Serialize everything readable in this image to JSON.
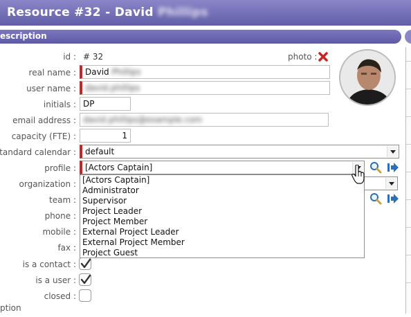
{
  "window": {
    "title": "Resource  #32 - David",
    "title_surname": "Phillips"
  },
  "section": {
    "title": "escription"
  },
  "fields": {
    "id_label": "id :",
    "id_value": "#  32",
    "photo_label": "photo :",
    "real_name_label": "real name :",
    "real_name_value": "David",
    "real_name_hidden": "Phillips",
    "user_name_label": "user name :",
    "user_name_hidden": "david.phillips",
    "initials_label": "initials :",
    "initials_value": "DP",
    "email_label": "email address :",
    "email_hidden": "david.phillips@example.com",
    "capacity_label": "capacity (FTE) :",
    "capacity_value": "1",
    "calendar_label": "standard calendar :",
    "calendar_value": "default",
    "profile_label": "profile :",
    "profile_value": "[Actors Captain]",
    "organization_label": "organization :",
    "team_label": "team :",
    "phone_label": "phone :",
    "mobile_label": "mobile :",
    "fax_label": "fax :",
    "is_contact_label": "is a contact :",
    "is_user_label": "is a user :",
    "closed_label": "closed :",
    "is_contact_checked": true,
    "is_user_checked": true,
    "closed_checked": false
  },
  "profile_options": [
    "[Actors Captain]",
    "Administrator",
    "Supervisor",
    "Project Leader",
    "Project Member",
    "External Project Leader",
    "External Project Member",
    "Project Guest"
  ],
  "footer": {
    "label": "ption"
  },
  "colors": {
    "header": "#625ea8",
    "required": "#cc2222",
    "delete": "#cc2222",
    "goto": "#2a6fb8"
  },
  "icons": [
    "delete-photo-icon",
    "search-icon",
    "goto-icon",
    "cursor-hand-icon",
    "checkmark-icon"
  ]
}
